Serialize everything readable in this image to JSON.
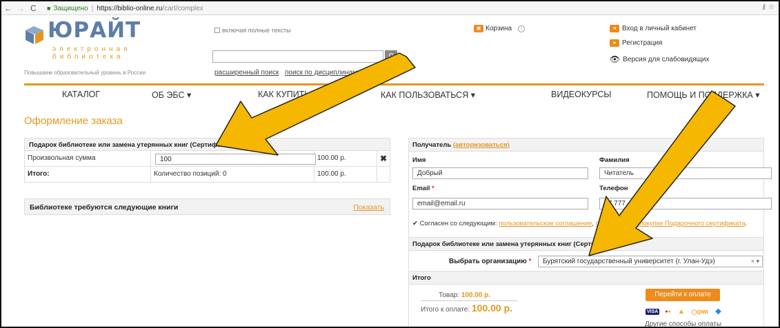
{
  "browser": {
    "secure_label": "Защищено",
    "url_host": "https://biblio-online.ru",
    "url_path": "/cart/complex"
  },
  "header": {
    "logo_text": "ЮРАЙТ",
    "logo_sub1": "электронная",
    "logo_sub2": "библиотека",
    "tagline": "Повышаем образовательный уровень в России",
    "fulltext_label": "включая полные тексты",
    "search_placeholder": "",
    "advanced_search": "расширенный поиск",
    "discipline_search": "поиск по дисциплинам",
    "cart_label": "Корзина",
    "login_label": "Вход в личный кабинет",
    "register_label": "Регистрация",
    "low_vision_label": "Версия для слабовидящих"
  },
  "menu": {
    "catalog": "КАТАЛОГ",
    "about": "ОБ ЭБС ▾",
    "how_buy": "КАК КУПИТЬ",
    "how_use": "КАК ПОЛЬЗОВАТЬСЯ ▾",
    "videos": "ВИДЕОКУРСЫ",
    "help": "ПОМОЩЬ И ПОДДЕРЖКА ▾"
  },
  "page_title": "Оформление заказа",
  "left_panel": {
    "heading": "Подарок библиотеке или замена утерянных книг (Сертификат)",
    "row1_label": "Произвольная сумма",
    "row1_value": "100",
    "row1_price": "100.00 р.",
    "row2_label": "Итого:",
    "row2_count_label": "Количество позиций: 0",
    "row2_price": "100.00 р.",
    "books_needed": "Библиотеке требуются следующие книги",
    "show_link": "Показать"
  },
  "right_panel": {
    "recipient_label": "Получатель",
    "auth_link": "(авторизоваться)",
    "first_name_label": "Имя",
    "first_name_value": "Добрый",
    "last_name_label": "Фамилия",
    "last_name_value": "Читатель",
    "email_label": "Email",
    "email_value": "email@email.ru",
    "phone_label": "Телефон",
    "phone_value": "+7 777",
    "agree_prefix": "Согласен со следующим:",
    "agree_link1": "пользовательское соглашение",
    "agree_link2": "соглашение о покупке Подарочного сертификата",
    "section_heading": "Подарок библиотеке или замена утерянных книг (Сертификат)",
    "org_label": "Выбрать организацию",
    "org_value": "Бурятский государственный университет (г. Улан-Удэ)",
    "total_heading": "Итого",
    "goods_label": "Товар:",
    "goods_value": "100.00 р.",
    "to_pay_label": "Итого к оплате:",
    "to_pay_value": "100.00 р.",
    "pay_button": "Перейти к оплате",
    "other_payment": "Другие способы оплаты"
  }
}
